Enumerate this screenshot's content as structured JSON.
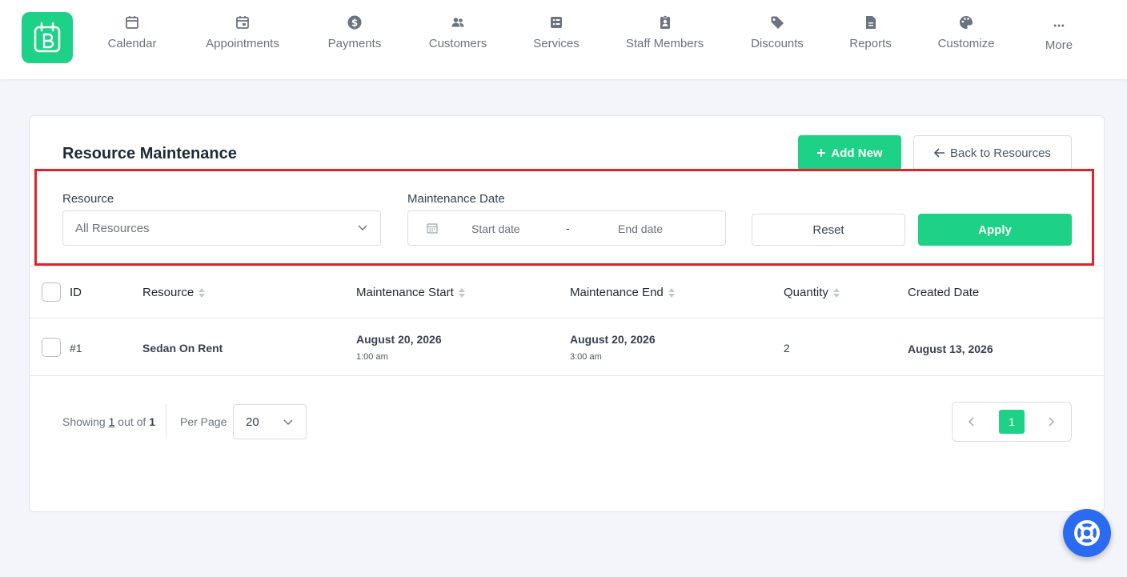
{
  "nav": {
    "items": [
      {
        "label": "Calendar",
        "icon": "calendar-icon"
      },
      {
        "label": "Appointments",
        "icon": "calendar-check-icon"
      },
      {
        "label": "Payments",
        "icon": "dollar-circle-icon"
      },
      {
        "label": "Customers",
        "icon": "users-icon"
      },
      {
        "label": "Services",
        "icon": "list-icon"
      },
      {
        "label": "Staff Members",
        "icon": "id-badge-icon"
      },
      {
        "label": "Discounts",
        "icon": "tag-icon"
      },
      {
        "label": "Reports",
        "icon": "file-icon"
      },
      {
        "label": "Customize",
        "icon": "palette-icon"
      },
      {
        "label": "More",
        "icon": "more-dots-icon"
      }
    ]
  },
  "page": {
    "title": "Resource Maintenance",
    "add_new": "Add New",
    "back_to_resources": "Back to Resources"
  },
  "filters": {
    "resource_label": "Resource",
    "resource_value": "All Resources",
    "date_label": "Maintenance Date",
    "start_placeholder": "Start date",
    "separator": "-",
    "end_placeholder": "End date",
    "reset": "Reset",
    "apply": "Apply"
  },
  "table": {
    "columns": [
      "ID",
      "Resource",
      "Maintenance Start",
      "Maintenance End",
      "Quantity",
      "Created Date"
    ],
    "rows": [
      {
        "id": "#1",
        "resource": "Sedan On Rent",
        "start_date": "August 20, 2026",
        "start_time": "1:00 am",
        "end_date": "August 20, 2026",
        "end_time": "3:00 am",
        "quantity": "2",
        "created": "August 13, 2026"
      }
    ]
  },
  "footer": {
    "showing_prefix": "Showing",
    "showing_count": "1",
    "showing_mid": "out of",
    "showing_total": "1",
    "per_page_label": "Per Page",
    "per_page_value": "20",
    "current_page": "1"
  },
  "colors": {
    "accent": "#1dd186",
    "highlight": "#e0232a",
    "help": "#2a6bf2"
  }
}
